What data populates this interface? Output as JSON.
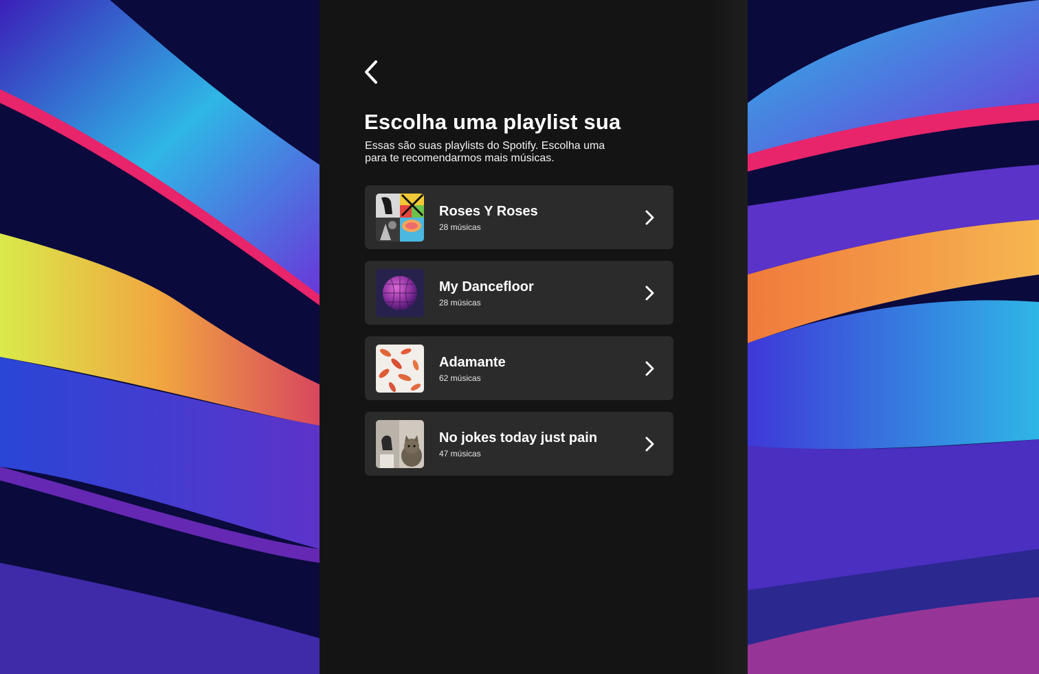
{
  "header": {
    "back_icon": "chevron-left-icon",
    "title": "Escolha uma playlist sua",
    "subtitle": "Essas são suas playlists do Spotify. Escolha uma para te recomendarmos mais músicas."
  },
  "playlists": [
    {
      "name": "Roses Y Roses",
      "count": "28 músicas",
      "cover_icon": "playlist-mosaic-cover"
    },
    {
      "name": "My Dancefloor",
      "count": "28 músicas",
      "cover_icon": "disco-ball-cover"
    },
    {
      "name": "Adamante",
      "count": "62 músicas",
      "cover_icon": "koi-fish-cover"
    },
    {
      "name": "No jokes today just pain",
      "count": "47 músicas",
      "cover_icon": "cat-photo-cover"
    }
  ],
  "colors": {
    "panel": "#141414",
    "card": "#2b2b2b",
    "text": "#ffffff",
    "background_deep": "#0b0a3a"
  }
}
